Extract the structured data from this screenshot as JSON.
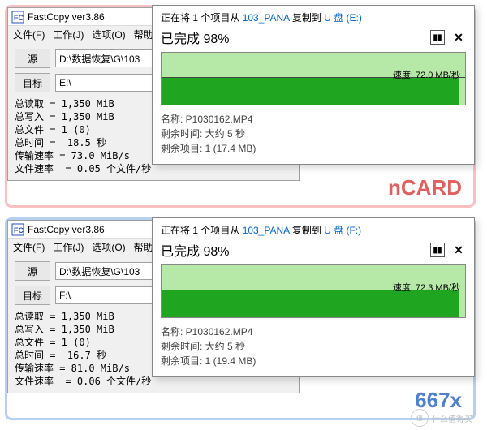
{
  "fastcopy_title": "FastCopy ver3.86",
  "menu": {
    "file": "文件(F)",
    "work": "工作(J)",
    "option": "选项(O)",
    "help": "帮助(H)"
  },
  "btn": {
    "source": "源",
    "target": "目标"
  },
  "top": {
    "source_path": "D:\\数据恢复\\G\\103",
    "target_path": "E:\\",
    "stats": "总读取 = 1,350 MiB\n总写入 = 1,350 MiB\n总文件 = 1 (0)\n总时间 =  18.5 秒\n传输速率 = 73.0 MiB/s\n文件速率  = 0.05 个文件/秒",
    "copy_header_1": "正在将 1 个项目从 ",
    "copy_header_src": "103_PANA",
    "copy_header_2": " 复制到 ",
    "copy_header_dst": "U 盘 (E:)",
    "done_label": "已完成 ",
    "done_value": "98%",
    "speed_label": "速度: 72.0 MB/秒",
    "name_line": "名称: P1030162.MP4",
    "time_line": "剩余时间: 大约 5 秒",
    "items_line": "剩余项目: 1 (17.4 MB)",
    "badge": "nCARD"
  },
  "bottom": {
    "source_path": "D:\\数据恢复\\G\\103",
    "target_path": "F:\\",
    "stats": "总读取 = 1,350 MiB\n总写入 = 1,350 MiB\n总文件 = 1 (0)\n总时间 =  16.7 秒\n传输速率 = 81.0 MiB/s\n文件速率  = 0.06 个文件/秒",
    "copy_header_1": "正在将 1 个项目从 ",
    "copy_header_src": "103_PANA",
    "copy_header_2": " 复制到 ",
    "copy_header_dst": "U 盘 (F:)",
    "done_label": "已完成 ",
    "done_value": "98%",
    "speed_label": "速度: 72.3 MB/秒",
    "name_line": "名称: P1030162.MP4",
    "time_line": "剩余时间: 大约 5 秒",
    "items_line": "剩余项目: 1 (19.4 MB)",
    "badge": "667x"
  },
  "watermark": "什么值得买"
}
